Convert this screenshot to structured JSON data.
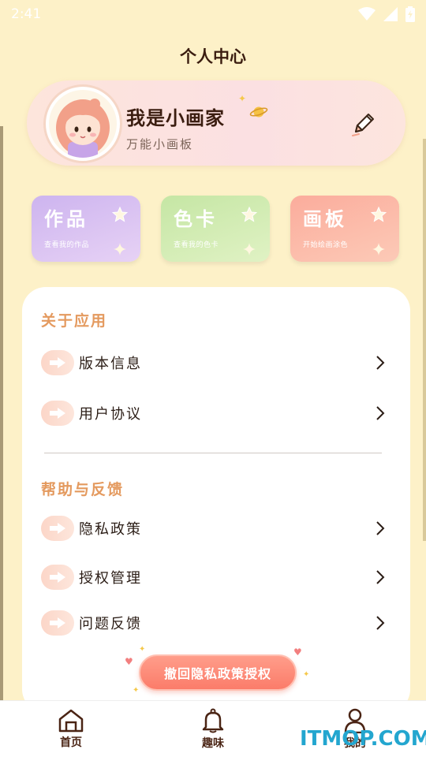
{
  "status_bar": {
    "time": "2:41"
  },
  "header": {
    "title": "个人中心"
  },
  "profile": {
    "name": "我是小画家",
    "subtitle": "万能小画板"
  },
  "quick_cards": [
    {
      "title": "作品",
      "subtitle": "查看我的作品"
    },
    {
      "title": "色卡",
      "subtitle": "查看我的色卡"
    },
    {
      "title": "画板",
      "subtitle": "开始绘画涂色"
    }
  ],
  "sections": {
    "about": {
      "title": "关于应用",
      "items": [
        {
          "label": "版本信息"
        },
        {
          "label": "用户协议"
        }
      ]
    },
    "help": {
      "title": "帮助与反馈",
      "items": [
        {
          "label": "隐私政策"
        },
        {
          "label": "授权管理"
        },
        {
          "label": "问题反馈"
        }
      ]
    }
  },
  "revoke_button": {
    "label": "撤回隐私政策授权"
  },
  "tabs": [
    {
      "label": "首页",
      "icon": "home-icon"
    },
    {
      "label": "趣味",
      "icon": "bell-icon"
    },
    {
      "label": "我的",
      "icon": "person-icon"
    }
  ],
  "watermark": "ITMOP.COM",
  "colors": {
    "background": "#fdf1c8",
    "section_title": "#e49a5f",
    "revoke_button": "#fb7c6a",
    "watermark": "#23a6cf"
  }
}
